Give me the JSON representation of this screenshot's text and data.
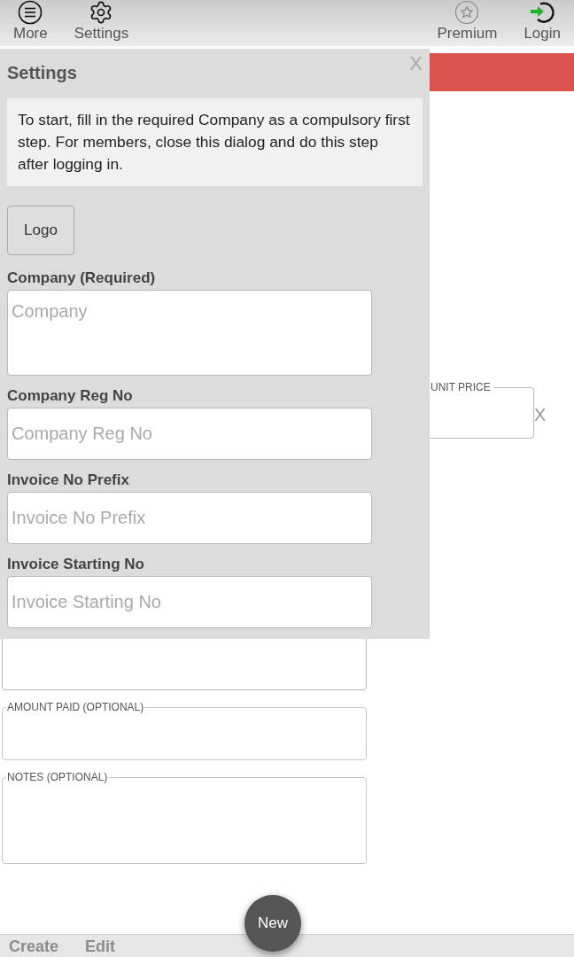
{
  "toolbar": {
    "left_items": [
      {
        "label": "More"
      },
      {
        "label": "Settings"
      }
    ],
    "right_items": [
      {
        "label": "Premium"
      },
      {
        "label": "Login"
      }
    ]
  },
  "dialog": {
    "title": "Settings",
    "close": "X",
    "notice": "To start, fill in the required Company as a compulsory first step. For members, close this dialog and do this step after logging in.",
    "logo_button": "Logo",
    "fields": [
      {
        "label": "Company (Required)",
        "placeholder": "Company",
        "kind": "textarea"
      },
      {
        "label": "Company Reg No",
        "placeholder": "Company Reg No",
        "kind": "input"
      },
      {
        "label": "Invoice No Prefix",
        "placeholder": "Invoice No Prefix",
        "kind": "input"
      },
      {
        "label": "Invoice Starting No",
        "placeholder": "Invoice Starting No",
        "kind": "input"
      }
    ]
  },
  "background_form": {
    "unit_price": {
      "label": "UNIT PRICE",
      "remove": "X"
    },
    "fields": [
      {
        "kind": "input"
      },
      {
        "label": "AMOUNT PAID (OPTIONAL)",
        "kind": "input"
      },
      {
        "label": "NOTES (OPTIONAL)",
        "kind": "textarea"
      }
    ]
  },
  "new_button": "New",
  "bottom_tabs": [
    {
      "label": "Create"
    },
    {
      "label": "Edit"
    }
  ]
}
